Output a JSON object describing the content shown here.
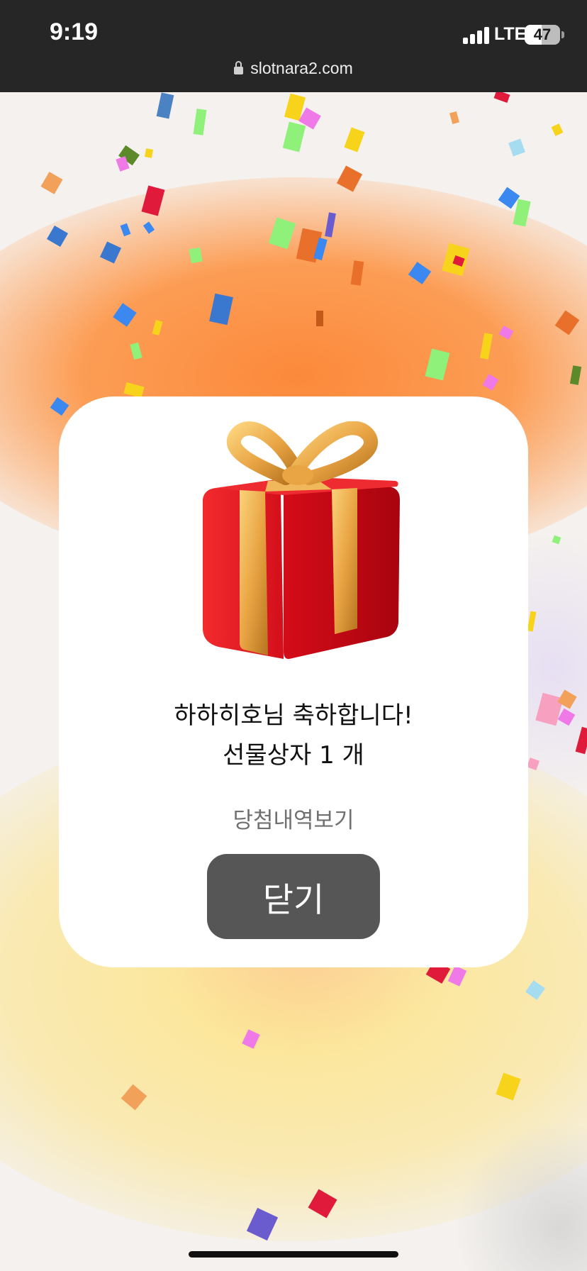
{
  "status_bar": {
    "time": "9:19",
    "network": "LTE",
    "battery": "47",
    "battery_level_percent": 47
  },
  "browser": {
    "url": "slotnara2.com"
  },
  "popup": {
    "gift_icon": "gift-box-icon",
    "message_line1": "하하히호님 축하합니다!",
    "message_line2": "선물상자 1 개",
    "history_link": "당첨내역보기",
    "close_button": "닫기"
  },
  "colors": {
    "card": "#ffffff",
    "button": "#565656",
    "link": "#707070",
    "status_bar": "#262626",
    "gift_red": "#e0131f",
    "ribbon_gold": "#e9a544"
  }
}
